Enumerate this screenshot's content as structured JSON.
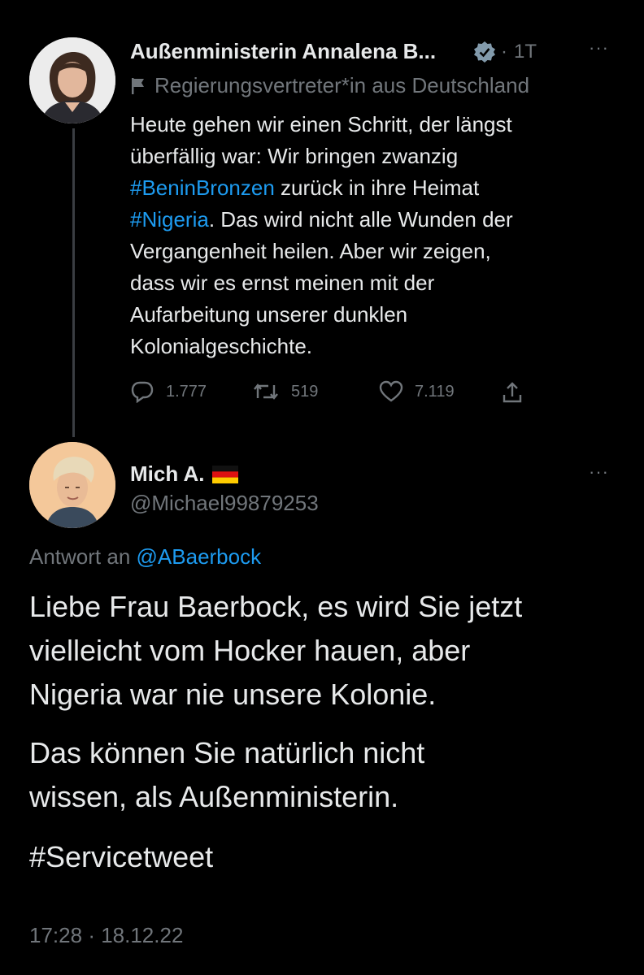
{
  "tweet1": {
    "name": "Außenministerin Annalena B...",
    "time": "1T",
    "label": "Regierungsvertreter*in aus Deutschland",
    "text_1": "Heute gehen wir einen Schritt, der längst",
    "text_2": "überfällig war: Wir bringen zwanzig",
    "hashtag_1": "#BeninBronzen",
    "text_3": " zurück in ihre Heimat",
    "hashtag_2": "#Nigeria",
    "text_4": ". Das wird nicht alle Wunden der",
    "text_5": "Vergangenheit heilen. Aber wir zeigen,",
    "text_6": "dass wir es ernst meinen mit der",
    "text_7": "Aufarbeitung unserer dunklen",
    "text_8": "Kolonialgeschichte.",
    "replies": "1.777",
    "retweets": "519",
    "likes": "7.119"
  },
  "tweet2": {
    "name": "Mich A.",
    "handle": "@Michael99879253",
    "reply_prefix": "Antwort an",
    "reply_to": "@ABaerbock",
    "line_1": "Liebe Frau Baerbock, es wird Sie jetzt",
    "line_2": "vielleicht vom Hocker hauen, aber",
    "line_3": "Nigeria war nie unsere Kolonie.",
    "line_4": "Das können Sie natürlich nicht",
    "line_5": "wissen, als Außenministerin.",
    "hashtag": "#Servicetweet",
    "time": "17:28",
    "date": "18.12.22"
  },
  "colors": {
    "background": "#000000",
    "text": "#e7e9ea",
    "muted": "#71767b",
    "link": "#1d9bf0",
    "verified": "#829aab"
  }
}
